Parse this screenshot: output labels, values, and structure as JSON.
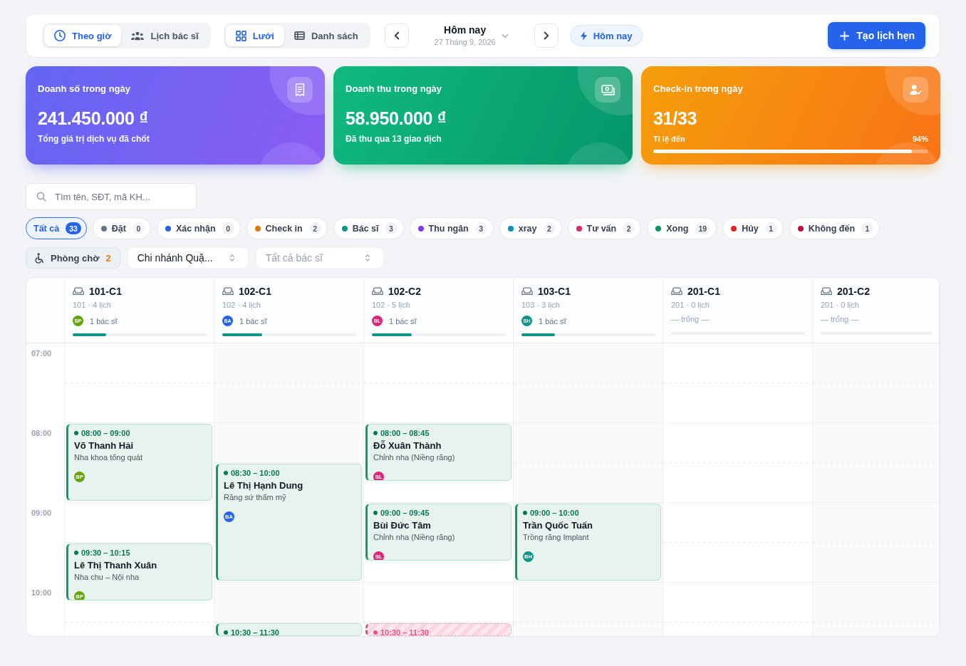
{
  "toolbar": {
    "view_modes": [
      {
        "label": "Theo giờ",
        "selected": true
      },
      {
        "label": "Lịch bác sĩ",
        "selected": false
      }
    ],
    "layouts": [
      {
        "label": "Lưới",
        "selected": true
      },
      {
        "label": "Danh sách",
        "selected": false
      }
    ],
    "date": {
      "title": "Hôm nay",
      "subtitle": "27 Tháng 9, 2026"
    },
    "today_button": "Hôm nay",
    "create_button": "Tạo lịch hẹn"
  },
  "stats": [
    {
      "kind": "amount",
      "title": "Doanh số trong ngày",
      "value": "241.450.000 ₫",
      "subtitle": "Tổng giá trị dịch vụ đã chốt",
      "color": "#6366f1"
    },
    {
      "kind": "amount",
      "title": "Doanh thu trong ngày",
      "value": "58.950.000 ₫",
      "subtitle": "Đã thu qua 13 giao dịch",
      "color": "#10b981"
    },
    {
      "kind": "progress",
      "title": "Check-in trong ngày",
      "value": "31/33",
      "progress_label": "Tỉ lệ đến",
      "progress_text": "94%",
      "level": 0.94,
      "color": "#f59e0b"
    }
  ],
  "search": {
    "placeholder": "Tìm tên, SĐT, mã KH..."
  },
  "status_filters": [
    {
      "label": "Tất cả",
      "count": "33",
      "selected": true
    },
    {
      "label": "Đặt",
      "count": "0",
      "selected": false,
      "color": "#64748b"
    },
    {
      "label": "Xác nhận",
      "count": "0",
      "selected": false,
      "color": "#2563eb"
    },
    {
      "label": "Check in",
      "count": "2",
      "selected": false,
      "color": "#d97706"
    },
    {
      "label": "Bác sĩ",
      "count": "3",
      "selected": false,
      "color": "#0d9488"
    },
    {
      "label": "Thu ngân",
      "count": "3",
      "selected": false,
      "color": "#7c3aed"
    },
    {
      "label": "xray",
      "count": "2",
      "selected": false,
      "color": "#0891b2"
    },
    {
      "label": "Tư vấn",
      "count": "2",
      "selected": false,
      "color": "#db2777"
    },
    {
      "label": "Xong",
      "count": "19",
      "selected": false,
      "color": "#059669"
    },
    {
      "label": "Hủy",
      "count": "1",
      "selected": false,
      "color": "#dc2626"
    },
    {
      "label": "Không đến",
      "count": "1",
      "selected": false,
      "color": "#be123c"
    }
  ],
  "waiting_room": {
    "label": "Phòng chờ",
    "count": "2"
  },
  "branch_select": {
    "value": "Chi nhánh Quậ..."
  },
  "doctor_select": {
    "placeholder": "Tất cả bác sĩ"
  },
  "calendar": {
    "hours": [
      "07:00",
      "08:00",
      "09:00",
      "10:00"
    ],
    "rooms": [
      {
        "name": "101-C1",
        "meta": "101 · 4 lịch",
        "doctor": {
          "initials": "BP",
          "color": "#65a30d",
          "label": "1 bác sĩ"
        },
        "level": 0.25,
        "appointments": [
          {
            "kind": "done",
            "time": "08:00 – 09:00",
            "patient": "Võ Thanh Hải",
            "service": "Nha khoa tổng quát",
            "doctor": {
              "initials": "BP",
              "color": "#65a30d"
            }
          },
          {
            "kind": "done",
            "time": "09:30 – 10:15",
            "patient": "Lê Thị Thanh Xuân",
            "service": "Nha chu – Nội nha",
            "doctor": {
              "initials": "BP",
              "color": "#65a30d"
            }
          }
        ]
      },
      {
        "name": "102-C1",
        "meta": "102 · 4 lịch",
        "doctor": {
          "initials": "BA",
          "color": "#2563eb",
          "label": "1 bác sĩ"
        },
        "level": 0.3,
        "appointments": [
          {
            "kind": "done",
            "time": "08:30 – 10:00",
            "patient": "Lê Thị Hạnh Dung",
            "service": "Răng sứ thẩm mỹ",
            "doctor": {
              "initials": "BA",
              "color": "#2563eb"
            }
          },
          {
            "kind": "done",
            "time": "10:30 – 11:30"
          }
        ]
      },
      {
        "name": "102-C2",
        "meta": "102 · 5 lịch",
        "doctor": {
          "initials": "BL",
          "color": "#db2777",
          "label": "1 bác sĩ"
        },
        "level": 0.3,
        "appointments": [
          {
            "kind": "done",
            "time": "08:00 – 08:45",
            "patient": "Đỗ Xuân Thành",
            "service": "Chỉnh nha (Niềng răng)",
            "doctor": {
              "initials": "BL",
              "color": "#db2777"
            }
          },
          {
            "kind": "done",
            "time": "09:00 – 09:45",
            "patient": "Bùi Đức Tâm",
            "service": "Chỉnh nha (Niềng răng)",
            "doctor": {
              "initials": "BL",
              "color": "#db2777"
            }
          },
          {
            "kind": "cancelled",
            "time": "10:30 – 11:30"
          }
        ]
      },
      {
        "name": "103-C1",
        "meta": "103 · 3 lịch",
        "doctor": {
          "initials": "BH",
          "color": "#0d9488",
          "label": "1 bác sĩ"
        },
        "level": 0.25,
        "appointments": [
          {
            "kind": "done",
            "time": "09:00 – 10:00",
            "patient": "Trần Quốc Tuấn",
            "service": "Trồng răng Implant",
            "doctor": {
              "initials": "BH",
              "color": "#0d9488"
            }
          }
        ]
      },
      {
        "name": "201-C1",
        "meta": "201 · 0 lịch",
        "empty_label": "— trống —"
      },
      {
        "name": "201-C2",
        "meta": "201 · 0 lịch",
        "empty_label": "— trống —"
      }
    ]
  }
}
